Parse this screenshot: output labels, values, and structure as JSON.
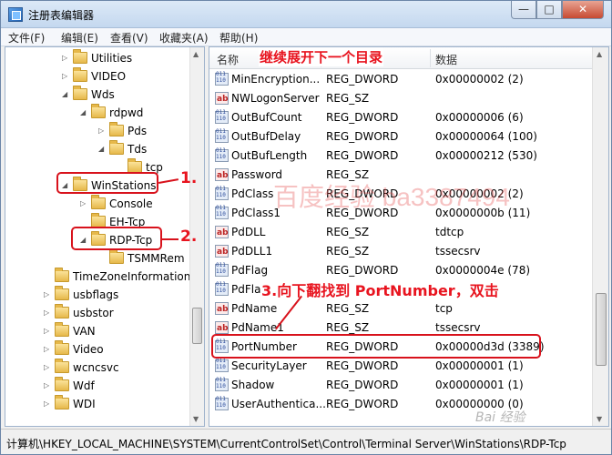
{
  "window": {
    "title": "注册表编辑器",
    "controls": {
      "minimize": "—",
      "maximize": "□",
      "close": "✕"
    }
  },
  "menu": [
    "文件(F)",
    "编辑(E)",
    "查看(V)",
    "收藏夹(A)",
    "帮助(H)"
  ],
  "tree": [
    {
      "label": "Utilities",
      "expanded": false
    },
    {
      "label": "VIDEO",
      "expanded": false
    },
    {
      "label": "Wds",
      "expanded": true
    },
    {
      "label": "rdpwd",
      "expanded": true
    },
    {
      "label": "Pds",
      "expanded": false
    },
    {
      "label": "Tds",
      "expanded": true
    },
    {
      "label": "tcp",
      "expanded": false
    },
    {
      "label": "WinStations",
      "expanded": true
    },
    {
      "label": "Console",
      "expanded": false
    },
    {
      "label": "EH-Tcp",
      "expanded": false
    },
    {
      "label": "RDP-Tcp",
      "expanded": true
    },
    {
      "label": "TSMMRem",
      "expanded": false
    },
    {
      "label": "TimeZoneInformation",
      "expanded": false
    },
    {
      "label": "usbflags",
      "expanded": false
    },
    {
      "label": "usbstor",
      "expanded": false
    },
    {
      "label": "VAN",
      "expanded": false
    },
    {
      "label": "Video",
      "expanded": false
    },
    {
      "label": "wcncsvc",
      "expanded": false
    },
    {
      "label": "Wdf",
      "expanded": false
    },
    {
      "label": "WDI",
      "expanded": false
    }
  ],
  "list": {
    "headers": {
      "name": "名称",
      "type": "类型",
      "data": "数据"
    },
    "rows": [
      {
        "name": "MinEncryption...",
        "type": "REG_DWORD",
        "data": "0x00000002 (2)",
        "icon": "dword"
      },
      {
        "name": "NWLogonServer",
        "type": "REG_SZ",
        "data": "",
        "icon": "sz"
      },
      {
        "name": "OutBufCount",
        "type": "REG_DWORD",
        "data": "0x00000006 (6)",
        "icon": "dword"
      },
      {
        "name": "OutBufDelay",
        "type": "REG_DWORD",
        "data": "0x00000064 (100)",
        "icon": "dword"
      },
      {
        "name": "OutBufLength",
        "type": "REG_DWORD",
        "data": "0x00000212 (530)",
        "icon": "dword"
      },
      {
        "name": "Password",
        "type": "REG_SZ",
        "data": "",
        "icon": "sz"
      },
      {
        "name": "PdClass",
        "type": "REG_DWORD",
        "data": "0x00000002 (2)",
        "icon": "dword"
      },
      {
        "name": "PdClass1",
        "type": "REG_DWORD",
        "data": "0x0000000b (11)",
        "icon": "dword"
      },
      {
        "name": "PdDLL",
        "type": "REG_SZ",
        "data": "tdtcp",
        "icon": "sz"
      },
      {
        "name": "PdDLL1",
        "type": "REG_SZ",
        "data": "tssecsrv",
        "icon": "sz"
      },
      {
        "name": "PdFlag",
        "type": "REG_DWORD",
        "data": "0x0000004e (78)",
        "icon": "dword"
      },
      {
        "name": "PdFla",
        "type": "",
        "data": "",
        "icon": "dword"
      },
      {
        "name": "PdName",
        "type": "REG_SZ",
        "data": "tcp",
        "icon": "sz"
      },
      {
        "name": "PdName1",
        "type": "REG_SZ",
        "data": "tssecsrv",
        "icon": "sz"
      },
      {
        "name": "PortNumber",
        "type": "REG_DWORD",
        "data": "0x00000d3d (3389)",
        "icon": "dword"
      },
      {
        "name": "SecurityLayer",
        "type": "REG_DWORD",
        "data": "0x00000001 (1)",
        "icon": "dword"
      },
      {
        "name": "Shadow",
        "type": "REG_DWORD",
        "data": "0x00000001 (1)",
        "icon": "dword"
      },
      {
        "name": "UserAuthentica...",
        "type": "REG_DWORD",
        "data": "0x00000000 (0)",
        "icon": "dword"
      }
    ]
  },
  "status": {
    "path": "计算机\\HKEY_LOCAL_MACHINE\\SYSTEM\\CurrentControlSet\\Control\\Terminal Server\\WinStations\\RDP-Tcp"
  },
  "annotations": {
    "top_note": "继续展开下一个目录",
    "step1": "1.",
    "step2": "2.",
    "step3": "3.向下翻找到 PortNumber，双击",
    "watermark": "百度经验 ba3387494",
    "baidu_logo": "Bai 经验",
    "color": "#e8141f"
  }
}
